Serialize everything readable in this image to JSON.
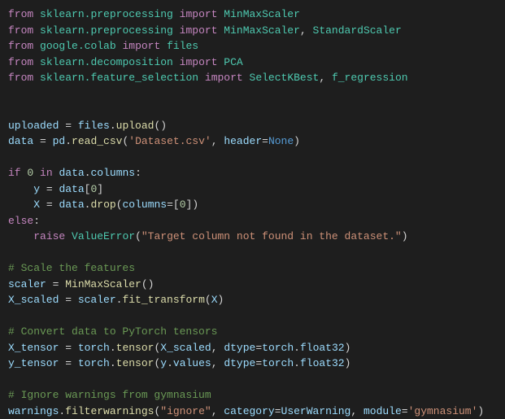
{
  "tokens": {
    "from": "from",
    "import": "import",
    "if": "if",
    "in": "in",
    "else": "else",
    "raise": "raise",
    "sklearn_preprocessing": "sklearn.preprocessing",
    "google_colab": "google.colab",
    "sklearn_decomposition": "sklearn.decomposition",
    "sklearn_feature_selection": "sklearn.feature_selection",
    "MinMaxScaler": "MinMaxScaler",
    "StandardScaler": "StandardScaler",
    "files": "files",
    "PCA": "PCA",
    "SelectKBest": "SelectKBest",
    "f_regression": "f_regression",
    "uploaded": "uploaded",
    "upload": "upload",
    "data": "data",
    "pd": "pd",
    "read_csv": "read_csv",
    "dataset_csv": "'Dataset.csv'",
    "header": "header",
    "None": "None",
    "columns": "columns",
    "y": "y",
    "X": "X",
    "drop": "drop",
    "zero": "0",
    "ValueError": "ValueError",
    "error_msg": "\"Target column not found in the dataset.\"",
    "comment_scale": "# Scale the features",
    "scaler": "scaler",
    "X_scaled": "X_scaled",
    "fit_transform": "fit_transform",
    "comment_tensor": "# Convert data to PyTorch tensors",
    "X_tensor": "X_tensor",
    "y_tensor": "y_tensor",
    "torch": "torch",
    "tensor": "tensor",
    "dtype": "dtype",
    "float32": "float32",
    "values": "values",
    "comment_warnings": "# Ignore warnings from gymnasium",
    "warnings": "warnings",
    "filterwarnings": "filterwarnings",
    "ignore": "\"ignore\"",
    "category": "category",
    "UserWarning": "UserWarning",
    "module": "module",
    "gymnasium": "'gymnasium'"
  }
}
